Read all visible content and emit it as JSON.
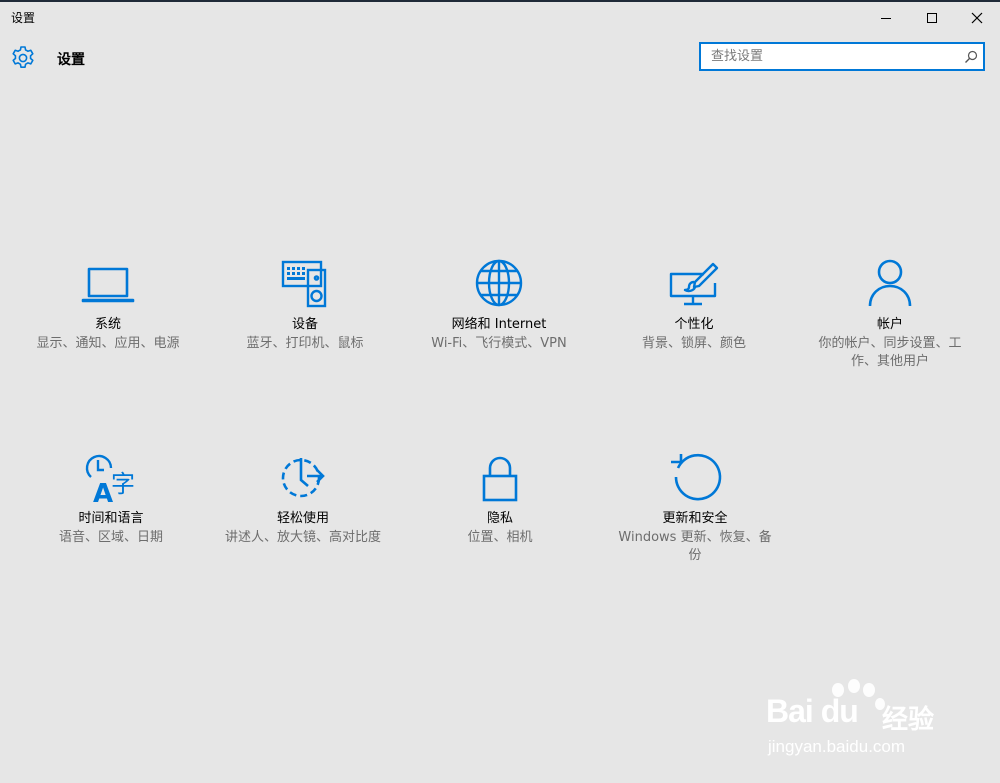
{
  "window": {
    "title": "设置"
  },
  "header": {
    "title": "设置"
  },
  "search": {
    "placeholder": "查找设置",
    "value": ""
  },
  "accent_color": "#0078d7",
  "categories": [
    {
      "icon": "laptop-icon",
      "name": "系统",
      "desc": "显示、通知、应用、电源"
    },
    {
      "icon": "keyboard-speaker-icon",
      "name": "设备",
      "desc": "蓝牙、打印机、鼠标"
    },
    {
      "icon": "globe-icon",
      "name": "网络和 Internet",
      "desc": "Wi-Fi、飞行模式、VPN"
    },
    {
      "icon": "paint-monitor-icon",
      "name": "个性化",
      "desc": "背景、锁屏、颜色"
    },
    {
      "icon": "person-icon",
      "name": "帐户",
      "desc": "你的帐户、同步设置、工作、其他用户"
    },
    {
      "icon": "clock-language-icon",
      "name": "时间和语言",
      "desc": "语音、区域、日期"
    },
    {
      "icon": "ease-of-access-icon",
      "name": "轻松使用",
      "desc": "讲述人、放大镜、高对比度"
    },
    {
      "icon": "lock-icon",
      "name": "隐私",
      "desc": "位置、相机"
    },
    {
      "icon": "refresh-icon",
      "name": "更新和安全",
      "desc": "Windows 更新、恢复、备份"
    }
  ],
  "watermark": {
    "brand": "Bai du",
    "brand_cn": "经验",
    "url": "jingyan.baidu.com"
  }
}
